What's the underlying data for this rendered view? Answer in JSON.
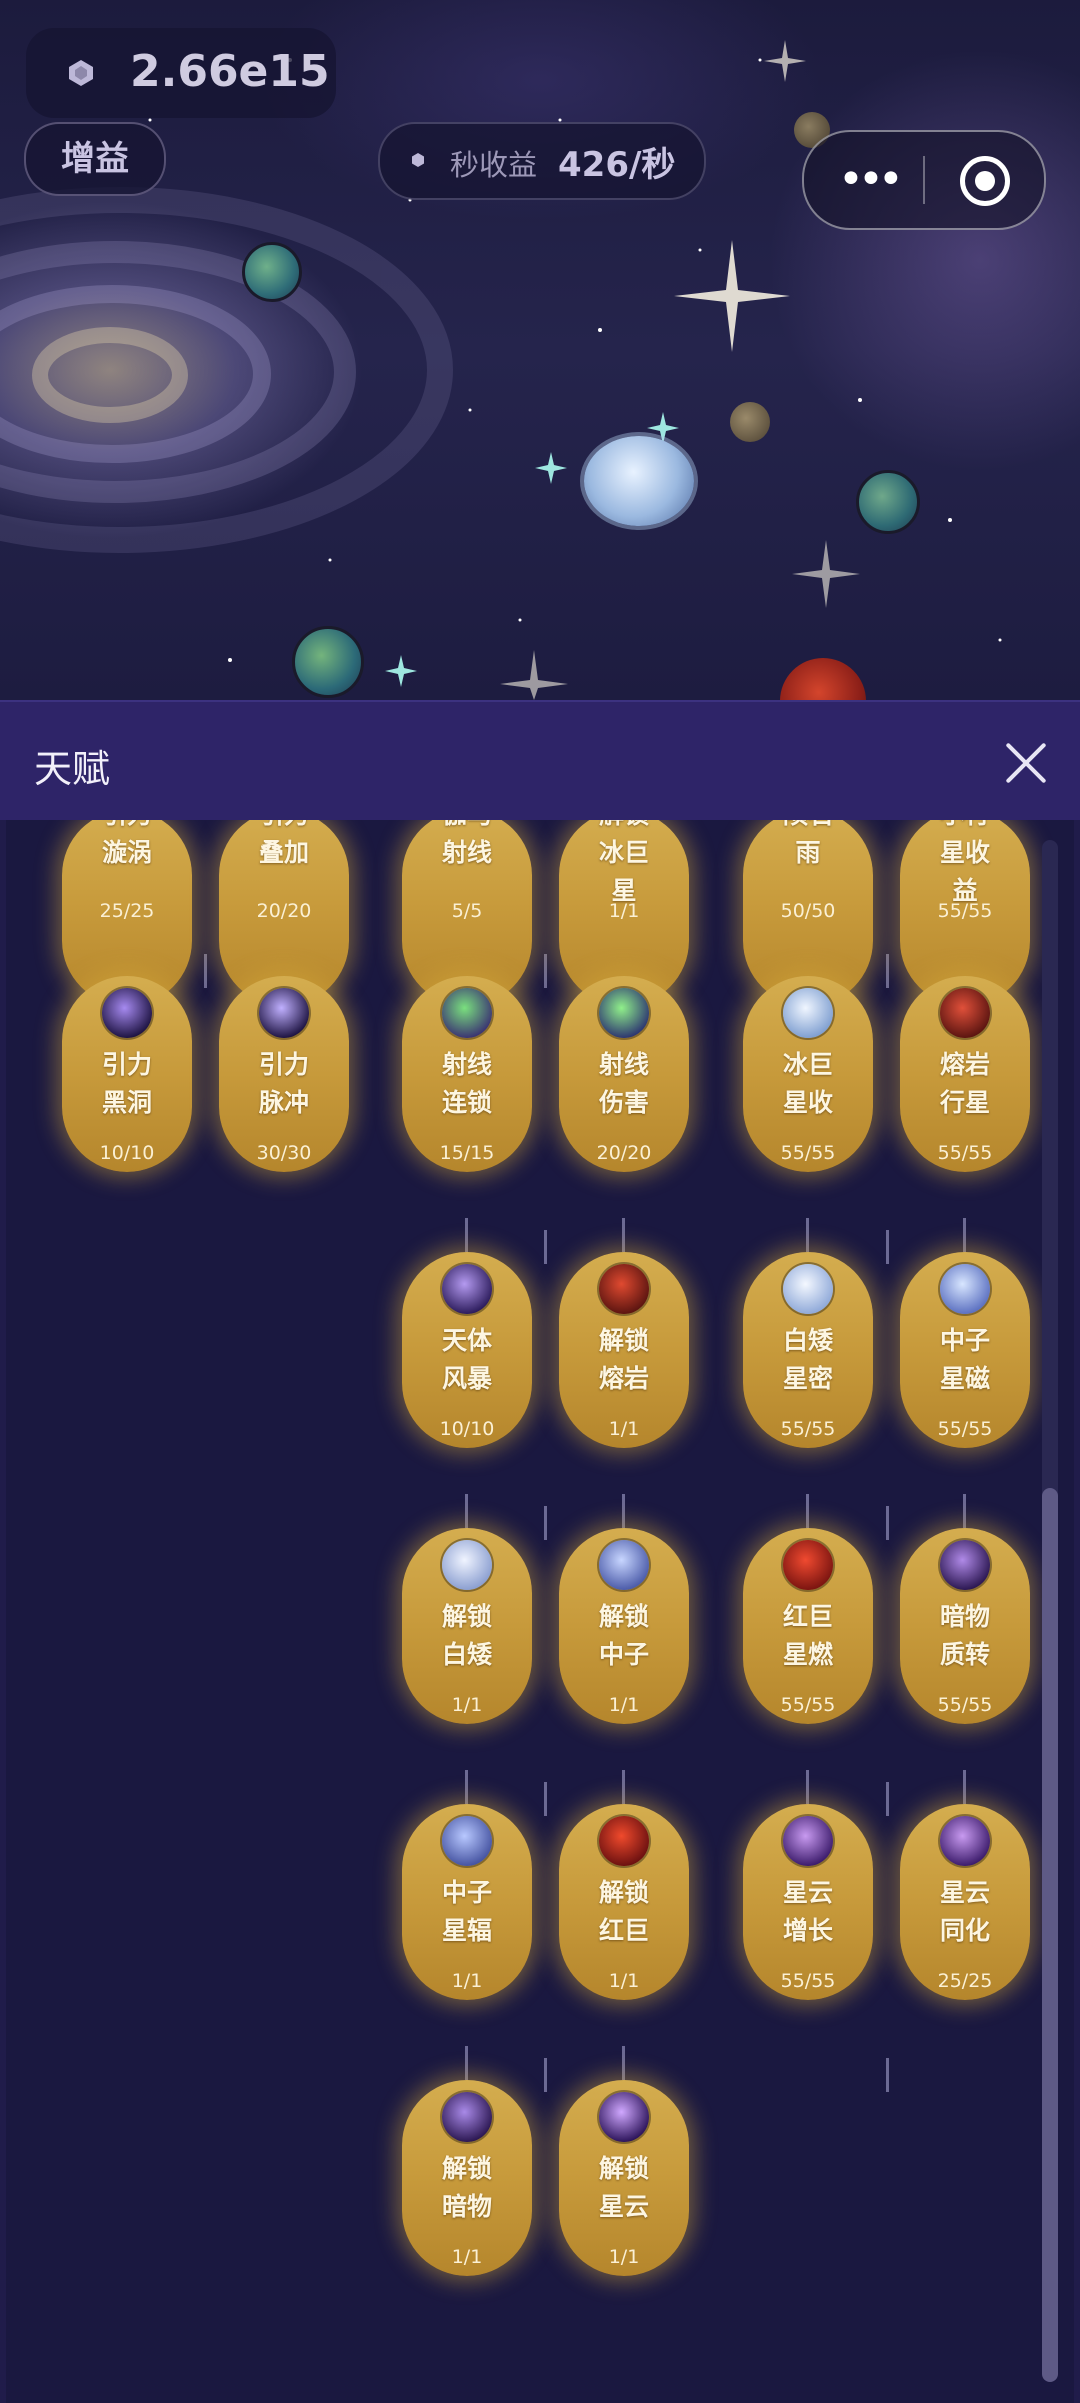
{
  "hud": {
    "currency_value": "2.66e15",
    "boost_label": "增益",
    "income_label": "秒收益",
    "income_value": "426/秒"
  },
  "panel": {
    "title": "天赋"
  },
  "colors": {
    "header": "#2e2468",
    "node_gold": "#c79a3b",
    "panel_bg": "#1a1840"
  },
  "talents": [
    {
      "name": "引力\n漩涡",
      "level": "25/25",
      "icon": "gravity-vortex-icon"
    },
    {
      "name": "引力\n叠加",
      "level": "20/20",
      "icon": "gravity-stack-icon"
    },
    {
      "name": "伽马\n射线",
      "level": "5/5",
      "icon": "gamma-ray-icon"
    },
    {
      "name": "解锁\n冰巨\n星",
      "level": "1/1",
      "icon": "ice-giant-icon"
    },
    {
      "name": "陨石\n雨",
      "level": "50/50",
      "icon": "meteor-shower-icon"
    },
    {
      "name": "小行\n星收\n益",
      "level": "55/55",
      "icon": "asteroid-income-icon"
    },
    {
      "name": "引力\n黑洞",
      "level": "10/10",
      "icon": "black-hole-icon"
    },
    {
      "name": "引力\n脉冲",
      "level": "30/30",
      "icon": "gravity-pulse-icon"
    },
    {
      "name": "射线\n连锁",
      "level": "15/15",
      "icon": "ray-chain-icon"
    },
    {
      "name": "射线\n伤害",
      "level": "20/20",
      "icon": "ray-damage-icon"
    },
    {
      "name": "冰巨\n星收\n益",
      "level": "55/55",
      "icon": "ice-giant-income-icon"
    },
    {
      "name": "熔岩\n行星\n收益",
      "level": "55/55",
      "icon": "lava-planet-income-icon"
    },
    {
      "name": "天体\n风暴",
      "level": "10/10",
      "icon": "celestial-storm-icon"
    },
    {
      "name": "解锁\n熔岩\n行星",
      "level": "1/1",
      "icon": "lava-planet-icon"
    },
    {
      "name": "白矮\n星密\n度",
      "level": "55/55",
      "icon": "white-dwarf-density-icon"
    },
    {
      "name": "中子\n星磁\n场",
      "level": "55/55",
      "icon": "neutron-magnetic-icon"
    },
    {
      "name": "解锁\n白矮\n星",
      "level": "1/1",
      "icon": "white-dwarf-icon"
    },
    {
      "name": "解锁\n中子\n星",
      "level": "1/1",
      "icon": "neutron-star-icon"
    },
    {
      "name": "红巨\n星燃\n烧",
      "level": "55/55",
      "icon": "red-giant-burn-icon"
    },
    {
      "name": "暗物\n质转\n化",
      "level": "55/55",
      "icon": "dark-matter-convert-icon"
    },
    {
      "name": "中子\n星辐\n射",
      "level": "1/1",
      "icon": "neutron-radiation-icon"
    },
    {
      "name": "解锁\n红巨\n星",
      "level": "1/1",
      "icon": "red-giant-icon"
    },
    {
      "name": "星云\n增长",
      "level": "55/55",
      "icon": "nebula-growth-icon"
    },
    {
      "name": "星云\n同化",
      "level": "25/25",
      "icon": "nebula-assimilate-icon"
    },
    {
      "name": "解锁\n暗物\n质",
      "level": "1/1",
      "icon": "dark-matter-icon"
    },
    {
      "name": "解锁\n星云",
      "level": "1/1",
      "icon": "nebula-icon"
    }
  ]
}
